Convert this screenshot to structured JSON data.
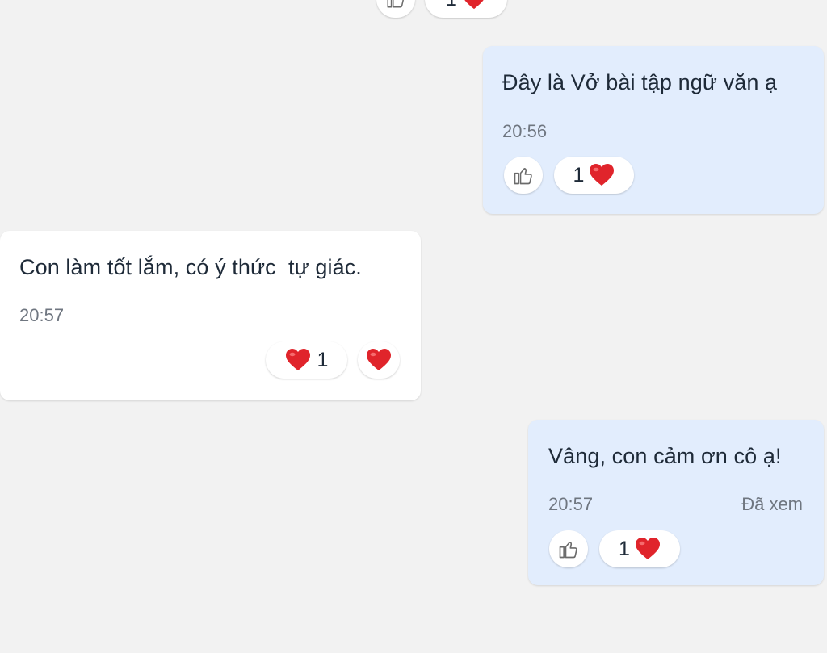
{
  "colors": {
    "background": "#f2f2f2",
    "sent_bubble": "#e2edfd",
    "received_bubble": "#ffffff",
    "heart": "#e0242b",
    "muted_text": "#6f7680"
  },
  "messages": [
    {
      "direction": "sent",
      "text": "Đây là Vở bài tập ngữ văn ạ",
      "time": "20:56",
      "reactions": {
        "like_icon": "thumbs-up-icon",
        "count": "1",
        "emoji": "heart-icon"
      }
    },
    {
      "direction": "received",
      "text": "Con làm tốt lắm, có ý thức  tự giác.",
      "time": "20:57",
      "reactions": {
        "count": "1",
        "emoji": "heart-icon",
        "react_button_icon": "heart-icon"
      }
    },
    {
      "direction": "sent",
      "text": "Vâng, con cảm ơn cô ạ!",
      "time": "20:57",
      "status": "Đã xem",
      "reactions": {
        "like_icon": "thumbs-up-icon",
        "count": "1",
        "emoji": "heart-icon"
      }
    }
  ],
  "previous_message": {
    "reactions": {
      "like_icon": "thumbs-up-icon",
      "count": "1",
      "emoji": "heart-icon"
    }
  }
}
